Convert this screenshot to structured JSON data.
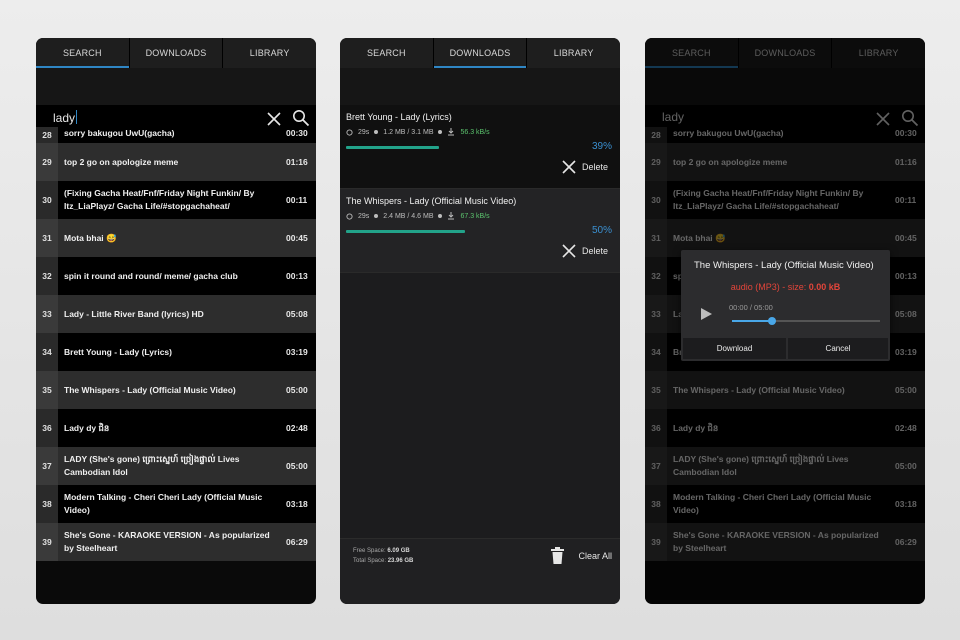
{
  "tabs": [
    "SEARCH",
    "DOWNLOADS",
    "LIBRARY"
  ],
  "search": {
    "query": "lady"
  },
  "results": [
    {
      "num": "28",
      "title": "sorry bakugou UwU(gacha)",
      "duration": "00:30"
    },
    {
      "num": "29",
      "title": "top 2 go on apologize meme",
      "duration": "01:16"
    },
    {
      "num": "30",
      "title": "(Fixing Gacha Heat/Fnf/Friday Night Funkin/ By Itz_LiaPlayz/ Gacha Life/#stopgachaheat/",
      "duration": "00:11"
    },
    {
      "num": "31",
      "title": "Mota bhai 😅",
      "duration": "00:45"
    },
    {
      "num": "32",
      "title": "spin it round and round/ meme/ gacha club",
      "duration": "00:13"
    },
    {
      "num": "33",
      "title": "Lady - Little River Band (lyrics) HD",
      "duration": "05:08"
    },
    {
      "num": "34",
      "title": "Brett Young - Lady (Lyrics)",
      "duration": "03:19"
    },
    {
      "num": "35",
      "title": "The Whispers - Lady (Official Music Video)",
      "duration": "05:00"
    },
    {
      "num": "36",
      "title": "Lady dy ជិន",
      "duration": "02:48"
    },
    {
      "num": "37",
      "title": "LADY  (She's gone) ព្រោះស្នេហ៍ ច្រៀងផ្ទាល់ Lives Cambodian Idol",
      "duration": "05:00"
    },
    {
      "num": "38",
      "title": "Modern Talking - Cheri Cheri Lady (Official Music Video)",
      "duration": "03:18"
    },
    {
      "num": "39",
      "title": "She's Gone - KARAOKE VERSION - As popularized by Steelheart",
      "duration": "06:29"
    }
  ],
  "downloads": [
    {
      "title": "Brett Young - Lady (Lyrics)",
      "elapsed": "29s",
      "size": "1.2 MB / 3.1 MB",
      "speed": "56.3 kB/s",
      "progress": "39%",
      "progress_value": 0.39,
      "delete_label": "Delete"
    },
    {
      "title": "The Whispers - Lady (Official Music Video)",
      "elapsed": "29s",
      "size": "2.4 MB / 4.6 MB",
      "speed": "67.3 kB/s",
      "progress": "50%",
      "progress_value": 0.5,
      "delete_label": "Delete"
    }
  ],
  "storage": {
    "free_label": "Free Space:",
    "free_value": "6.09 GB",
    "total_label": "Total Space:",
    "total_value": "23.96 GB",
    "clear_label": "Clear All"
  },
  "dialog": {
    "title": "The Whispers - Lady (Official Music Video)",
    "format_prefix": "audio (MP3) - size:",
    "format_size": "0.00 kB",
    "time": "00:00 / 05:00",
    "playback_progress": 0.27,
    "download_label": "Download",
    "cancel_label": "Cancel"
  },
  "colors": {
    "accent": "#2f86c4",
    "progress": "#22a38a",
    "speed": "#5cc46e",
    "warning": "#e2453a"
  }
}
